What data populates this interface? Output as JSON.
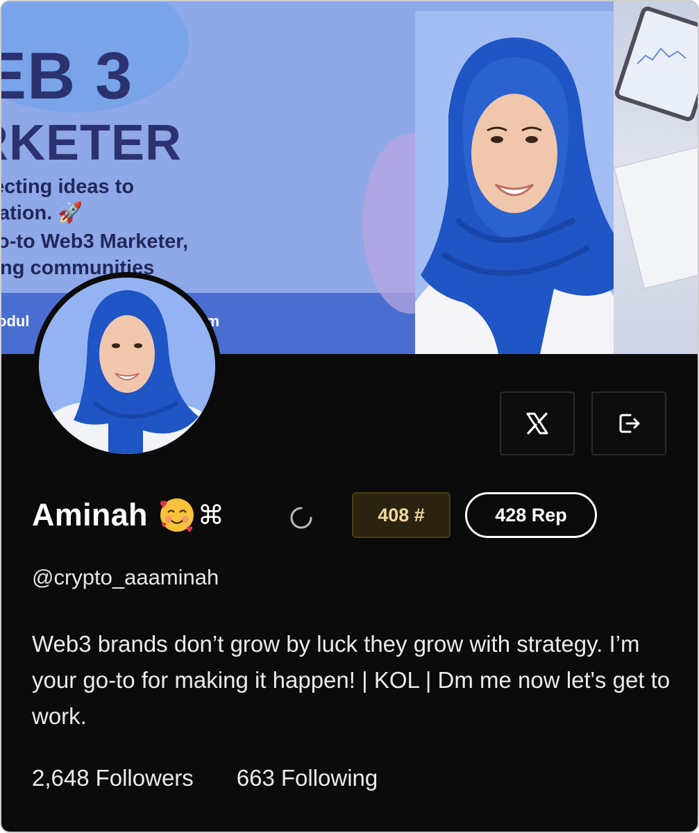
{
  "banner": {
    "headline": "EB 3",
    "subheadline": "RKETER",
    "tagline_lines": [
      "ecting ideas to",
      "ation. 🚀",
      "o-to Web3 Marketer,",
      "ng communities"
    ],
    "email_left": "odul",
    "email_right": "il.com"
  },
  "profile": {
    "name": "Aminah",
    "name_symbol": "⌘",
    "rank_badge": "408 #",
    "rep_badge": "428 Rep",
    "handle": "@crypto_aaaminah",
    "bio": "Web3 brands don’t grow by luck they grow with strategy. I’m your go-to for making it happen! | KOL | Dm me now let's get to work."
  },
  "stats": {
    "followers_count": "2,648",
    "followers_label": "Followers",
    "following_count": "663",
    "following_label": "Following"
  },
  "actions": {
    "x_icon": "x-logo-icon",
    "logout_icon": "logout-icon"
  },
  "colors": {
    "background": "#0b0b0b",
    "banner": "#8ea8e8",
    "banner_strip": "#4a6ed0",
    "headline_text": "#2c3270",
    "hijab_blue": "#1f55c4",
    "rank_badge_bg": "#2a2310",
    "rank_badge_text": "#f0d6a0"
  }
}
